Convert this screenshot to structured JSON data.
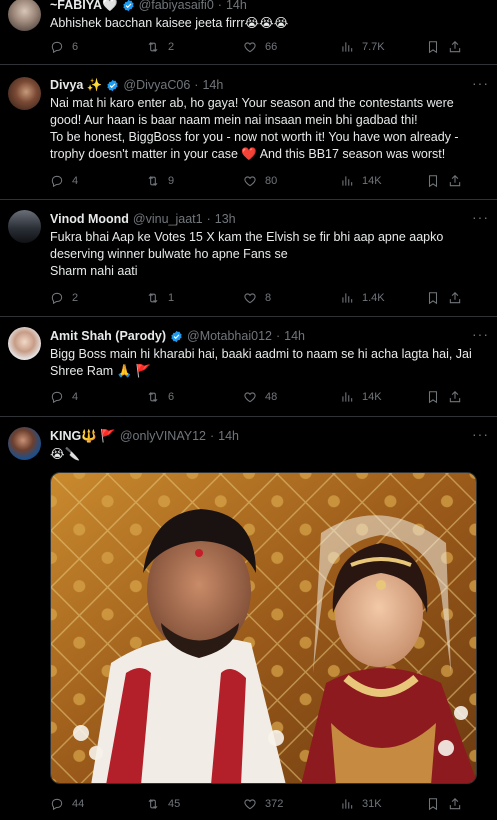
{
  "colors": {
    "background": "#000000",
    "text": "#e7e9ea",
    "muted": "#71767b",
    "verified": "#1d9bf0",
    "divider": "#2f3336"
  },
  "icons": {
    "reply": "reply-icon",
    "retweet": "retweet-icon",
    "like": "heart-icon",
    "views": "views-icon",
    "bookmark": "bookmark-icon",
    "share": "share-icon",
    "more": "more-icon",
    "verified": "verified-badge-icon"
  },
  "tweets": [
    {
      "name": "~FABIYA🤍",
      "handle": "@fabiyasaifi0",
      "time": "14h",
      "text": "Abhishek bacchan kaisee jeeta firrr😭😭😭",
      "replies": "6",
      "retweets": "2",
      "likes": "66",
      "views": "7.7K"
    },
    {
      "name": "Divya ✨",
      "handle": "@DivyaC06",
      "time": "14h",
      "text_lines": [
        "Nai mat hi karo enter ab, ho gaya! Your season and the contestants were",
        "good! Aur haan is baar naam mein nai insaan mein bhi gadbad thi!",
        "To be honest, BiggBoss for you - now not worth it! You have won already -",
        "trophy doesn't matter in your case ❤️ And this BB17 season was worst!"
      ],
      "replies": "4",
      "retweets": "9",
      "likes": "80",
      "views": "14K"
    },
    {
      "name": "Vinod Moond",
      "handle": "@vinu_jaat1",
      "time": "13h",
      "text_lines": [
        "Fukra bhai Aap ke Votes 15 X kam the Elvish se fir bhi aap apne aapko",
        "deserving winner bulwate ho apne Fans se",
        "Sharm nahi aati"
      ],
      "replies": "2",
      "retweets": "1",
      "likes": "8",
      "views": "1.4K"
    },
    {
      "name": "Amit Shah (Parody)",
      "handle": "@Motabhai012",
      "time": "14h",
      "text_lines": [
        "Bigg Boss main hi kharabi hai, baaki aadmi to naam se hi acha lagta hai, Jai",
        "Shree Ram 🙏 🚩"
      ],
      "replies": "4",
      "retweets": "6",
      "likes": "48",
      "views": "14K"
    },
    {
      "name": "KING🔱 🚩",
      "handle": "@onlyVINAY12",
      "time": "14h",
      "text": "😭🔪",
      "replies": "44",
      "retweets": "45",
      "likes": "372",
      "views": "31K"
    }
  ]
}
